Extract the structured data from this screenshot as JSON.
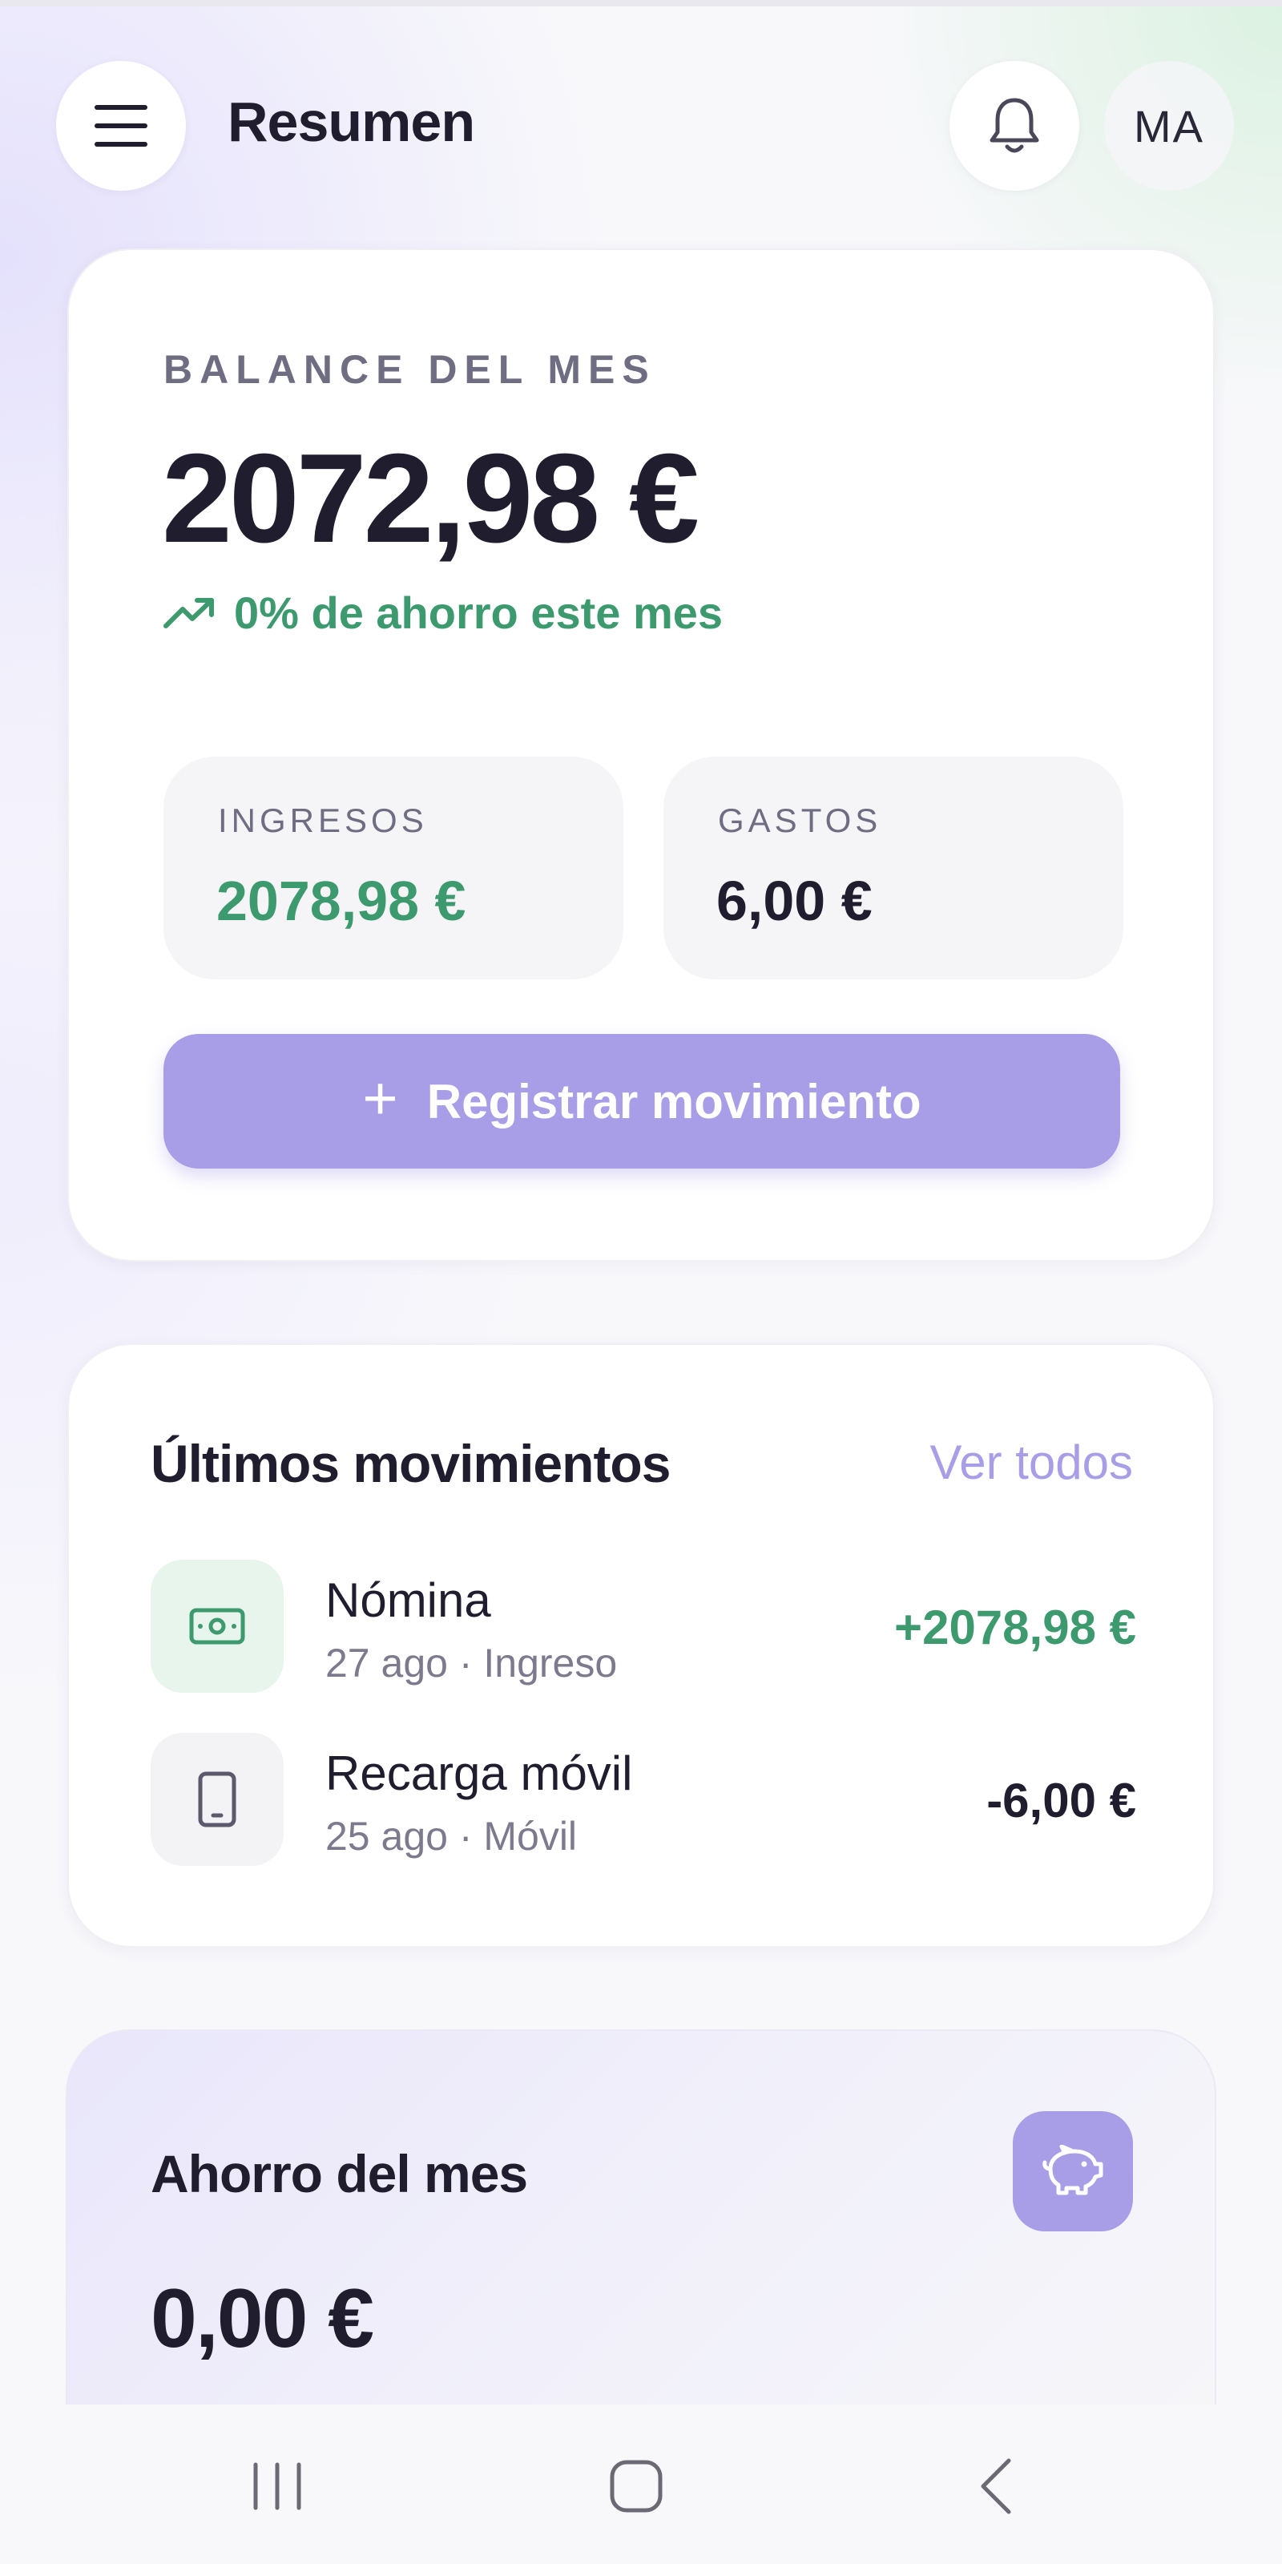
{
  "header": {
    "title": "Resumen",
    "avatar_initials": "MA",
    "menu_icon": "hamburger-menu-icon",
    "bell_icon": "bell-icon"
  },
  "balance": {
    "label": "BALANCE DEL MES",
    "value": "2072,98 €",
    "savings_text": "0% de ahorro este mes",
    "income_label": "INGRESOS",
    "income_value": "2078,98 €",
    "expense_label": "GASTOS",
    "expense_value": "6,00 €",
    "register_button": "Registrar movimiento"
  },
  "movements": {
    "title": "Últimos movimientos",
    "see_all": "Ver todos",
    "items": [
      {
        "name": "Nómina",
        "meta": "27 ago · Ingreso",
        "amount": "+2078,98 €",
        "icon": "cash-icon"
      },
      {
        "name": "Recarga móvil",
        "meta": "25 ago · Móvil",
        "amount": "-6,00 €",
        "icon": "smartphone-icon"
      }
    ]
  },
  "savings": {
    "title": "Ahorro del mes",
    "value": "0,00 €",
    "icon": "piggy-bank-icon"
  },
  "colors": {
    "accent": "#a79ee7",
    "positive": "#3d9a6f",
    "text_dark": "#1f1d2e"
  }
}
